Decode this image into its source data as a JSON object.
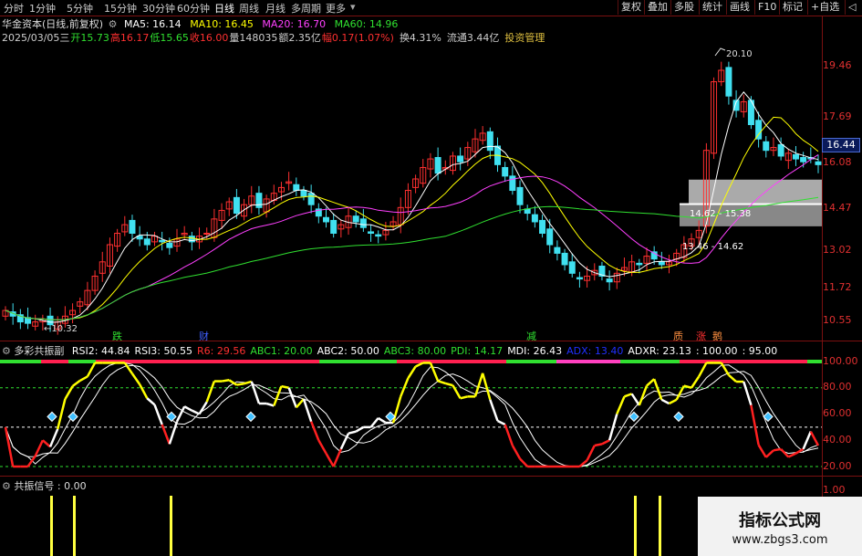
{
  "toolbar": {
    "timeframes": [
      "分时",
      "1分钟",
      "5分钟",
      "15分钟",
      "30分钟",
      "60分钟",
      "日线",
      "周线",
      "月线",
      "多周期",
      "更多"
    ],
    "active_timeframe": "日线",
    "buttons": [
      "复权",
      "叠加",
      "多股",
      "统计",
      "画线",
      "F10",
      "标记",
      "+自选",
      "◁"
    ]
  },
  "header": {
    "stock_name": "华金资本(日线,前复权)",
    "ma": [
      {
        "label": "MA5: 16.14",
        "color": "#ffffff"
      },
      {
        "label": "MA10: 16.45",
        "color": "#ffff00"
      },
      {
        "label": "MA20: 16.70",
        "color": "#ff40ff"
      },
      {
        "label": "MA60: 14.96",
        "color": "#30e030"
      }
    ],
    "ohlc_fields": [
      {
        "text": "2025/03/05三",
        "color": "#cfcfcf"
      },
      {
        "text": "开15.73",
        "color": "#30e030"
      },
      {
        "text": "高16.17",
        "color": "#ff3030"
      },
      {
        "text": "低15.65",
        "color": "#30e030"
      },
      {
        "text": "收16.00",
        "color": "#ff3030"
      },
      {
        "text": "量148035",
        "color": "#cfcfcf"
      },
      {
        "text": "额2.35亿",
        "color": "#cfcfcf"
      },
      {
        "text": "幅0.17(1.07%)",
        "color": "#ff3030"
      },
      {
        "text": "换4.31%",
        "color": "#cfcfcf"
      },
      {
        "text": "流通3.44亿",
        "color": "#cfcfcf"
      },
      {
        "text": "投资管理",
        "color": "#e0c040"
      }
    ]
  },
  "price_axis": {
    "labels": [
      "19.46",
      "17.69",
      "16.08",
      "14.47",
      "13.02",
      "11.72",
      "10.55"
    ]
  },
  "current_price": "16.44",
  "annotations": {
    "high_label": "20.10",
    "low_label": "←10.32",
    "zone_label_1": "14.62 - 15.38",
    "zone_label_2": "13.46 - 14.62"
  },
  "event_labels": [
    {
      "text": "跌",
      "color": "#30e030"
    },
    {
      "text": "财",
      "color": "#4060ff"
    },
    {
      "text": "减",
      "color": "#30e030"
    },
    {
      "text": "质",
      "color": "#ff9040"
    },
    {
      "text": "涨",
      "color": "#ff3030"
    },
    {
      "text": "鹅",
      "color": "#ff9040"
    }
  ],
  "indicator_panel": {
    "title": "多彩共振副",
    "values": [
      {
        "text": "RSI2: 44.84",
        "color": "#ffffff"
      },
      {
        "text": "RSI3: 50.55",
        "color": "#ffffff"
      },
      {
        "text": "R6: 29.56",
        "color": "#ff3030"
      },
      {
        "text": "ABC1: 20.00",
        "color": "#30e030"
      },
      {
        "text": "ABC2: 50.00",
        "color": "#ffffff"
      },
      {
        "text": "ABC3: 80.00",
        "color": "#30e030"
      },
      {
        "text": "PDI: 14.17",
        "color": "#30e030"
      },
      {
        "text": "MDI: 26.43",
        "color": "#ffffff"
      },
      {
        "text": "ADX: 13.40",
        "color": "#2030ff"
      },
      {
        "text": "ADXR: 23.13",
        "color": "#ffffff"
      },
      {
        "text": ": 100.00",
        "color": "#ffffff"
      },
      {
        "text": ": 95.00",
        "color": "#ffffff"
      }
    ],
    "axis_labels": [
      "100.00",
      "80.00",
      "60.00",
      "40.00",
      "20.00"
    ]
  },
  "signal_panel": {
    "title": "共振信号",
    "value": ": 0.00",
    "axis_label": "1.00"
  },
  "watermark": {
    "title": "指标公式网",
    "url": "www.zbgs3.com"
  },
  "colors": {
    "up": "#ff3030",
    "down": "#40e0f0",
    "ma5": "#ffffff",
    "ma10": "#ffff00",
    "ma20": "#ff40ff",
    "ma60": "#30e030",
    "separator": "#7a1010"
  }
}
